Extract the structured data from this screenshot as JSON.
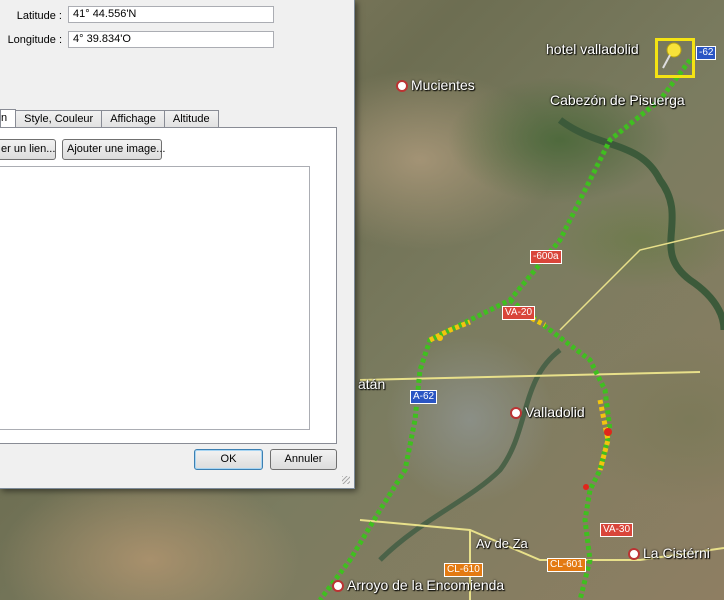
{
  "dialog": {
    "latitude_label": "Latitude :",
    "latitude_value": "41° 44.556'N",
    "longitude_label": "Longitude :",
    "longitude_value": "4° 39.834'O",
    "tabs": [
      {
        "label": "n",
        "active": true
      },
      {
        "label": "Style, Couleur",
        "active": false
      },
      {
        "label": "Affichage",
        "active": false
      },
      {
        "label": "Altitude",
        "active": false
      }
    ],
    "add_link_button": "er un lien...",
    "add_image_button": "Ajouter une image...",
    "ok_button": "OK",
    "cancel_button": "Annuler"
  },
  "map": {
    "places": {
      "hotel": "hotel valladolid",
      "mucientes": "Mucientes",
      "cabezon": "Cabezón de Pisuerga",
      "valladolid": "Valladolid",
      "zaratan": "atán",
      "arroyo": "Arroyo de la Encomienda",
      "cisterniga": "La Cistérni",
      "av_zamora": "Av de Za"
    },
    "shields": {
      "s1": "-62",
      "s2": "-600a",
      "s3": "VA-20",
      "s4": "A-62",
      "s5": "CL-610",
      "s6": "CL-601",
      "s7": "VA-30"
    },
    "colors": {
      "track_green": "#3fbf1f",
      "track_yellow": "#f2c40f",
      "track_red": "#e0261c",
      "pin_highlight": "#f4e313"
    },
    "icons": [
      "pushpin-icon",
      "place-dot-icon"
    ]
  }
}
